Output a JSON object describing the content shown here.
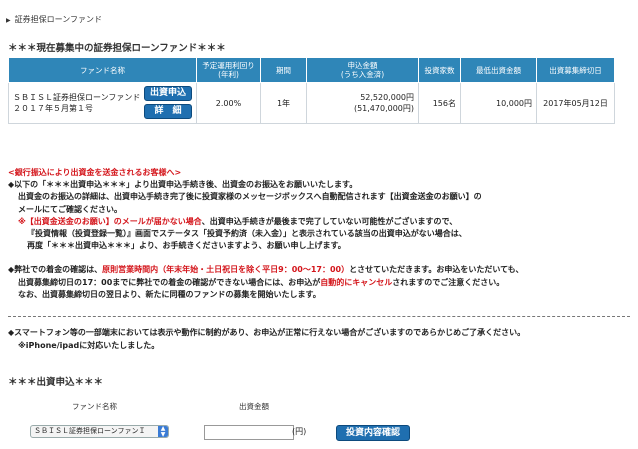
{
  "breadcrumb": {
    "label": "証券担保ローンファンド"
  },
  "section_title": "＊＊＊現在募集中の証券担保ローンファンド＊＊＊",
  "table": {
    "headers": [
      "ファンド名称",
      "予定運用利回り\n(年利)",
      "期間",
      "申込金額\n(うち入金済)",
      "投資家数",
      "最低出資金額",
      "出資募集締切日"
    ],
    "rows": [
      {
        "name_line1": "ＳＢＩＳＬ証券担保ローンファンド",
        "name_line2": "２０１７年５月第１号",
        "apply_button": "出資申込",
        "detail_button": "詳　細",
        "yield": "2.00%",
        "term": "1年",
        "amount": "52,520,000円",
        "amount_paid": "(51,470,000円)",
        "investors": "156名",
        "min_amount": "10,000円",
        "deadline": "2017年05月12日"
      }
    ]
  },
  "notes": {
    "heading": "<銀行振込により出資金を送金されるお客様へ>",
    "p1_line1": "◆以下の「＊＊＊出資申込＊＊＊」より出資申込手続き後、出資金のお振込をお願いいたします。",
    "p1_line2": "出資金のお振込の詳細は、出資申込手続き完了後に投資家様のメッセージボックスへ自動配信されます【出資金送金のお願い】の",
    "p1_line3": "メールにてご確認ください。",
    "p1_warn_prefix": "※",
    "p1_warn_red": "【出資金送金のお願い】のメールが届かない場合",
    "p1_warn_rest": "、出資申込手続きが最後まで完了していない可能性がございますので、",
    "p1_line5": "『投資情報（投資登録一覧）』画面でステータス「投資予約済（未入金）」と表示されている該当の出資申込がない場合は、",
    "p1_line6": "再度「＊＊＊出資申込＊＊＊」より、お手続きくださいますよう、お願い申し上げます。",
    "p2_a": "◆弊社での着金の確認は、",
    "p2_red": "原則営業時間内（年末年始・土日祝日を除く平日9：00〜17：00）",
    "p2_b": "とさせていただきます。お申込をいただいても、",
    "p2_line2_a": "出資募集締切日の17：00までに弊社での着金の確認ができない場合には、お申込が",
    "p2_line2_red": "自動的にキャンセル",
    "p2_line2_b": "されますのでご注意ください。",
    "p2_line3": "なお、出資募集締切日の翌日より、新たに同種のファンドの募集を開始いたします。",
    "p3_line1": "◆スマートフォン等の一部端末においては表示や動作に制約があり、お申込が正常に行えない場合がございますのであらかじめご了承ください。",
    "p3_line2": "※iPhone/ipadに対応いたしました。"
  },
  "order": {
    "title": "＊＊＊出資申込＊＊＊",
    "fund_label": "ファンド名称",
    "amount_label": "出資金額",
    "fund_selected": "ＳＢＩＳＬ証券担保ローンファンＩ",
    "amount_value": "",
    "yen_label": "(円)",
    "confirm_button": "投資内容確認"
  },
  "colors": {
    "header_bg": "#2f86b8",
    "button_bg": "#1f6fb0",
    "warning_red": "#d4151b"
  }
}
